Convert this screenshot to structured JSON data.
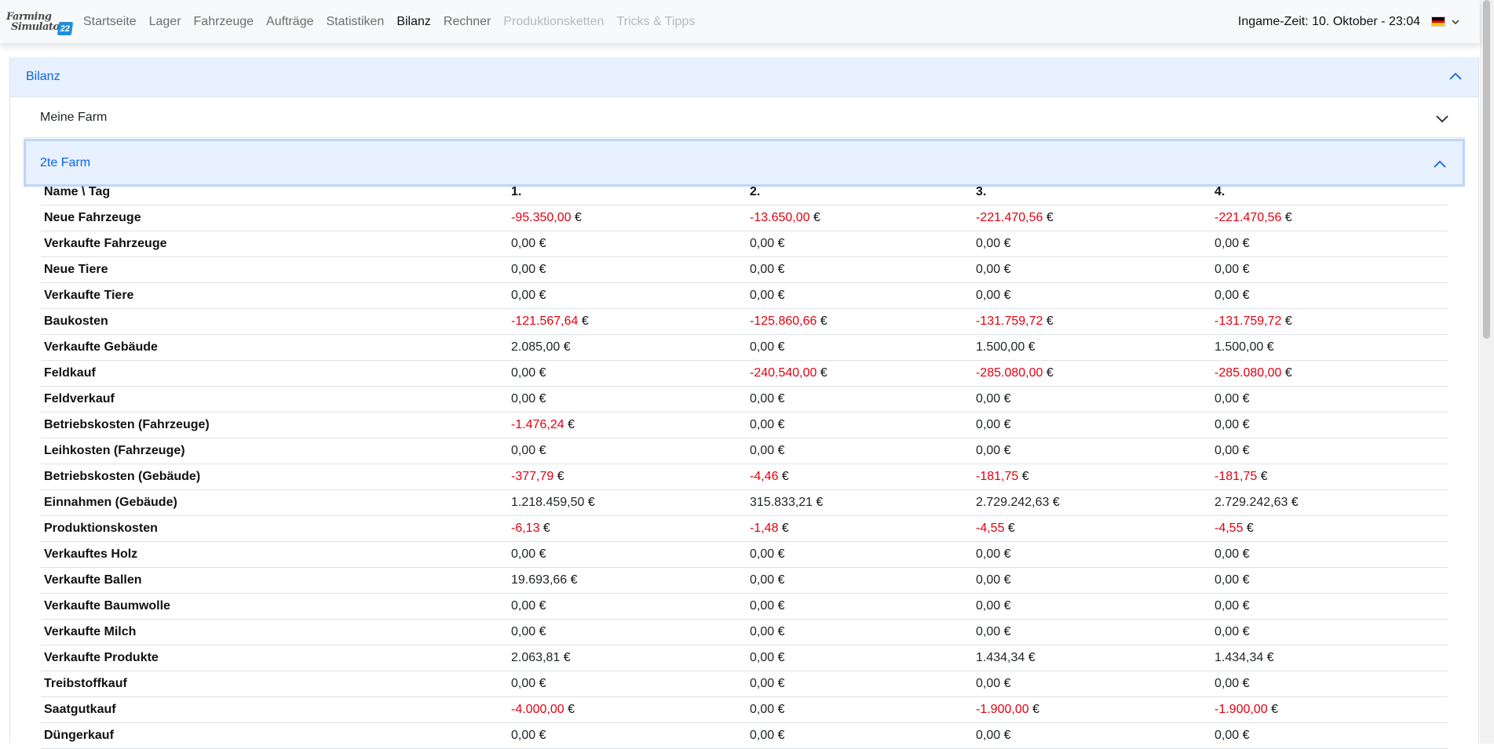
{
  "nav": {
    "logo_line1": "Farming",
    "logo_line2": "Simulator",
    "logo_badge": "22",
    "links": [
      {
        "label": "Startseite",
        "state": "normal"
      },
      {
        "label": "Lager",
        "state": "normal"
      },
      {
        "label": "Fahrzeuge",
        "state": "normal"
      },
      {
        "label": "Aufträge",
        "state": "normal"
      },
      {
        "label": "Statistiken",
        "state": "normal"
      },
      {
        "label": "Bilanz",
        "state": "active"
      },
      {
        "label": "Rechner",
        "state": "normal"
      },
      {
        "label": "Produktionsketten",
        "state": "disabled"
      },
      {
        "label": "Tricks & Tipps",
        "state": "disabled"
      }
    ],
    "ingame_time": "Ingame-Zeit: 10. Oktober - 23:04",
    "language_flag": "de-flag-icon"
  },
  "accordion": {
    "title": "Bilanz",
    "farm1": "Meine Farm",
    "farm2": "2te Farm"
  },
  "colors": {
    "accent": "#0c63e4",
    "accordion_bg": "#e7f1ff",
    "negative": "#e3000f"
  },
  "table": {
    "headers": [
      "Name \\ Tag",
      "1.",
      "2.",
      "3.",
      "4."
    ],
    "rows": [
      {
        "name": "Neue Fahrzeuge",
        "values": [
          "-95.350,00",
          "-13.650,00",
          "-221.470,56",
          "-221.470,56"
        ]
      },
      {
        "name": "Verkaufte Fahrzeuge",
        "values": [
          "0,00",
          "0,00",
          "0,00",
          "0,00"
        ]
      },
      {
        "name": "Neue Tiere",
        "values": [
          "0,00",
          "0,00",
          "0,00",
          "0,00"
        ]
      },
      {
        "name": "Verkaufte Tiere",
        "values": [
          "0,00",
          "0,00",
          "0,00",
          "0,00"
        ]
      },
      {
        "name": "Baukosten",
        "values": [
          "-121.567,64",
          "-125.860,66",
          "-131.759,72",
          "-131.759,72"
        ]
      },
      {
        "name": "Verkaufte Gebäude",
        "values": [
          "2.085,00",
          "0,00",
          "1.500,00",
          "1.500,00"
        ]
      },
      {
        "name": "Feldkauf",
        "values": [
          "0,00",
          "-240.540,00",
          "-285.080,00",
          "-285.080,00"
        ]
      },
      {
        "name": "Feldverkauf",
        "values": [
          "0,00",
          "0,00",
          "0,00",
          "0,00"
        ]
      },
      {
        "name": "Betriebskosten (Fahrzeuge)",
        "values": [
          "-1.476,24",
          "0,00",
          "0,00",
          "0,00"
        ]
      },
      {
        "name": "Leihkosten (Fahrzeuge)",
        "values": [
          "0,00",
          "0,00",
          "0,00",
          "0,00"
        ]
      },
      {
        "name": "Betriebskosten (Gebäude)",
        "values": [
          "-377,79",
          "-4,46",
          "-181,75",
          "-181,75"
        ]
      },
      {
        "name": "Einnahmen (Gebäude)",
        "values": [
          "1.218.459,50",
          "315.833,21",
          "2.729.242,63",
          "2.729.242,63"
        ]
      },
      {
        "name": "Produktionskosten",
        "values": [
          "-6,13",
          "-1,48",
          "-4,55",
          "-4,55"
        ]
      },
      {
        "name": "Verkauftes Holz",
        "values": [
          "0,00",
          "0,00",
          "0,00",
          "0,00"
        ]
      },
      {
        "name": "Verkaufte Ballen",
        "values": [
          "19.693,66",
          "0,00",
          "0,00",
          "0,00"
        ]
      },
      {
        "name": "Verkaufte Baumwolle",
        "values": [
          "0,00",
          "0,00",
          "0,00",
          "0,00"
        ]
      },
      {
        "name": "Verkaufte Milch",
        "values": [
          "0,00",
          "0,00",
          "0,00",
          "0,00"
        ]
      },
      {
        "name": "Verkaufte Produkte",
        "values": [
          "2.063,81",
          "0,00",
          "1.434,34",
          "1.434,34"
        ]
      },
      {
        "name": "Treibstoffkauf",
        "values": [
          "0,00",
          "0,00",
          "0,00",
          "0,00"
        ]
      },
      {
        "name": "Saatgutkauf",
        "values": [
          "-4.000,00",
          "0,00",
          "-1.900,00",
          "-1.900,00"
        ]
      },
      {
        "name": "Düngerkauf",
        "values": [
          "0,00",
          "0,00",
          "0,00",
          "0,00"
        ]
      }
    ],
    "currency": "€"
  }
}
